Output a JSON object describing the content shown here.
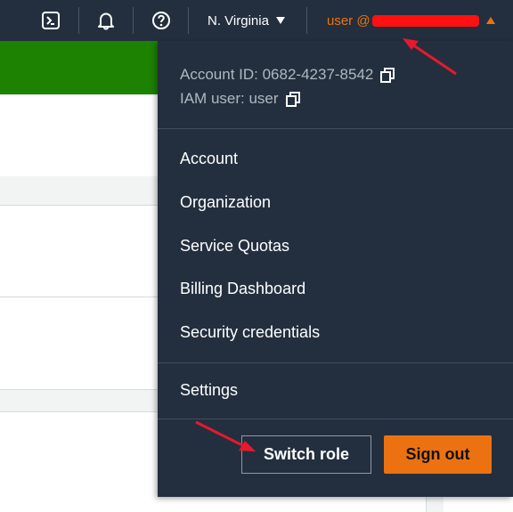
{
  "topbar": {
    "icons": [
      "cloudshell-icon",
      "bell-icon",
      "help-icon"
    ],
    "region_label": "N. Virginia",
    "user_label": "user @"
  },
  "account_menu": {
    "account_id_label": "Account ID: 0682-4237-8542",
    "iam_user_label": "IAM user: user",
    "items": [
      {
        "label": "Account"
      },
      {
        "label": "Organization"
      },
      {
        "label": "Service Quotas"
      },
      {
        "label": "Billing Dashboard"
      },
      {
        "label": "Security credentials"
      }
    ],
    "settings_label": "Settings",
    "switch_role_label": "Switch role",
    "sign_out_label": "Sign out"
  },
  "colors": {
    "nav_bg": "#232f3e",
    "accent_orange": "#ec7211",
    "success_green": "#1d8102",
    "annotation_red": "#e8192c",
    "redaction": "#ff1111"
  }
}
